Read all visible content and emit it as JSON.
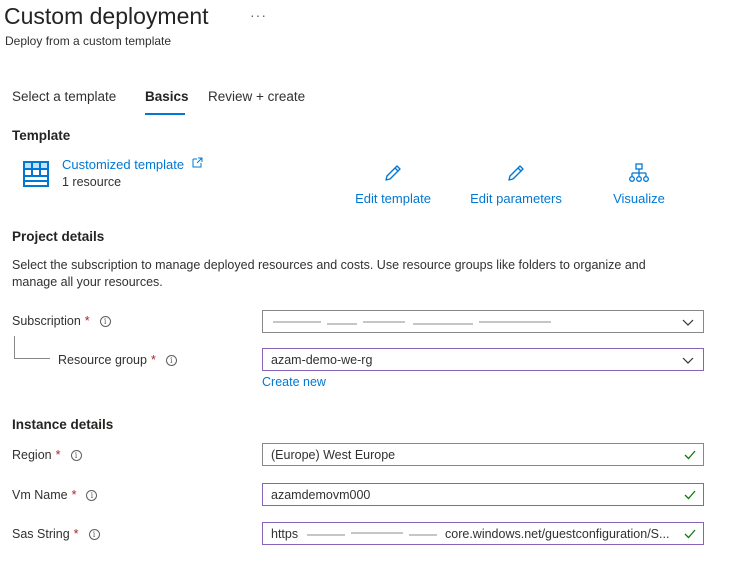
{
  "header": {
    "title": "Custom deployment",
    "more": "···",
    "subtitle": "Deploy from a custom template"
  },
  "tabs": [
    {
      "label": "Select a template",
      "active": false
    },
    {
      "label": "Basics",
      "active": true
    },
    {
      "label": "Review + create",
      "active": false
    }
  ],
  "template": {
    "section_title": "Template",
    "link_label": "Customized template",
    "resource_count": "1 resource",
    "actions": [
      {
        "label": "Edit template",
        "icon": "pencil-icon"
      },
      {
        "label": "Edit parameters",
        "icon": "pencil-icon"
      },
      {
        "label": "Visualize",
        "icon": "hierarchy-icon"
      }
    ]
  },
  "project": {
    "section_title": "Project details",
    "description": "Select the subscription to manage deployed resources and costs. Use resource groups like folders to organize and manage all your resources.",
    "subscription": {
      "label": "Subscription",
      "value": ""
    },
    "resource_group": {
      "label": "Resource group",
      "value": "azam-demo-we-rg"
    },
    "create_new": "Create new"
  },
  "instance": {
    "section_title": "Instance details",
    "region": {
      "label": "Region",
      "value": "(Europe) West Europe"
    },
    "vm_name": {
      "label": "Vm Name",
      "value": "azamdemovm000"
    },
    "sas_string": {
      "label": "Sas String",
      "value_prefix": "https",
      "value_suffix": "core.windows.net/guestconfiguration/S..."
    }
  },
  "required_marker": "*",
  "info_marker": "i",
  "colors": {
    "accent": "#0078d4",
    "required": "#a4262c",
    "valid_check": "#107c10",
    "focus_border": "#8764b8"
  }
}
